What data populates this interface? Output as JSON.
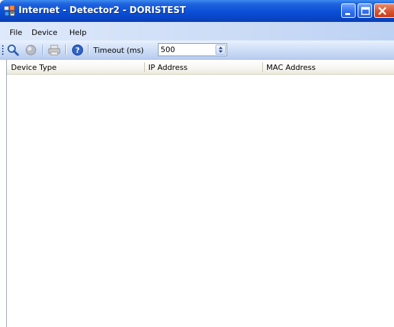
{
  "window": {
    "title": "Internet - Detector2 - DORISTEST"
  },
  "menu": {
    "items": [
      {
        "label": "File"
      },
      {
        "label": "Device"
      },
      {
        "label": "Help"
      }
    ]
  },
  "toolbar": {
    "icons": [
      "search-icon",
      "stop-icon",
      "print-icon",
      "help-icon"
    ],
    "timeout_label": "Timeout (ms)",
    "timeout_value": "500"
  },
  "list": {
    "columns": [
      {
        "label": "Device Type"
      },
      {
        "label": "IP Address"
      },
      {
        "label": "MAC Address"
      }
    ],
    "rows": []
  },
  "colors": {
    "titlebar": "#0a4fd6",
    "menubar": "#cdddf7",
    "close_button": "#d8512c"
  }
}
